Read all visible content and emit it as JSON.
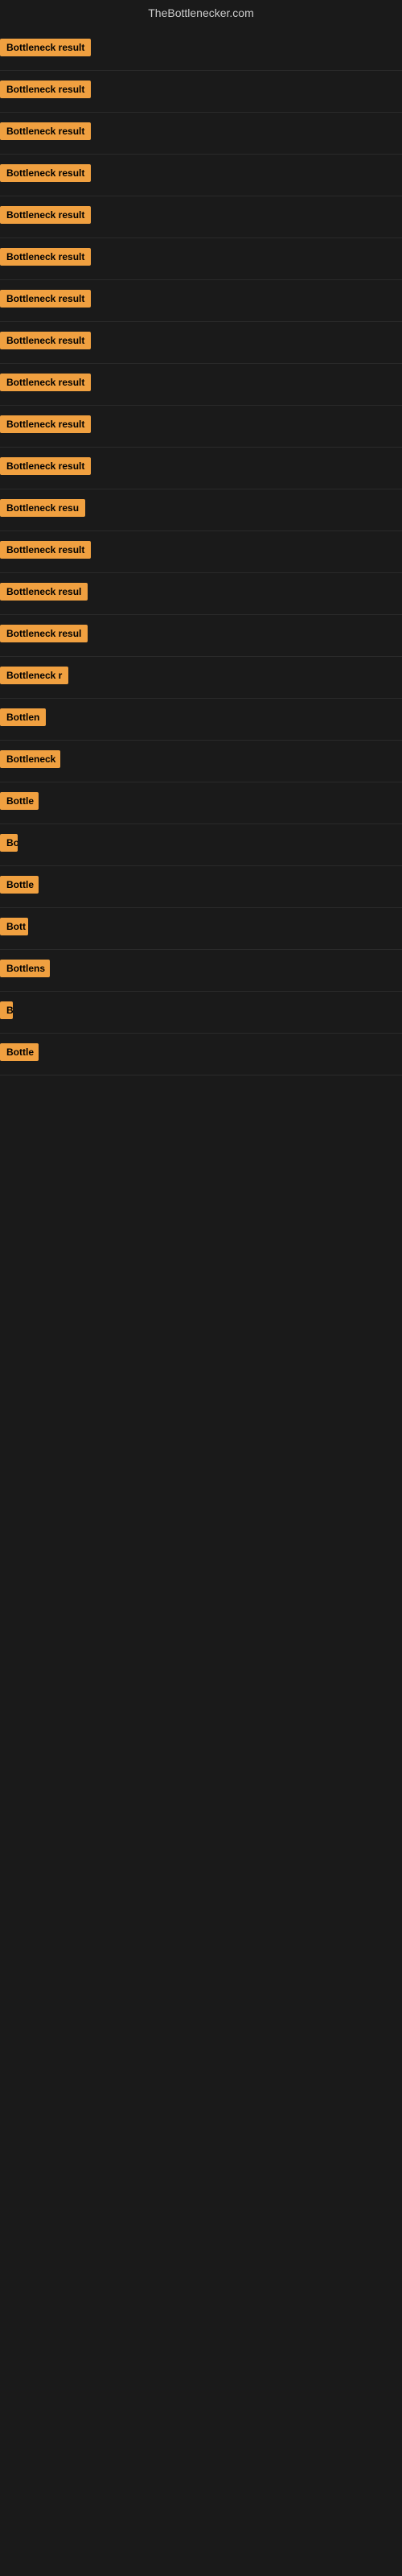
{
  "site": {
    "title": "TheBottlenecker.com"
  },
  "badges": [
    {
      "id": 1,
      "label": "Bottleneck result",
      "visible_width": "full"
    },
    {
      "id": 2,
      "label": "Bottleneck result",
      "visible_width": "full"
    },
    {
      "id": 3,
      "label": "Bottleneck result",
      "visible_width": "full"
    },
    {
      "id": 4,
      "label": "Bottleneck result",
      "visible_width": "full"
    },
    {
      "id": 5,
      "label": "Bottleneck result",
      "visible_width": "full"
    },
    {
      "id": 6,
      "label": "Bottleneck result",
      "visible_width": "full"
    },
    {
      "id": 7,
      "label": "Bottleneck result",
      "visible_width": "full"
    },
    {
      "id": 8,
      "label": "Bottleneck result",
      "visible_width": "full"
    },
    {
      "id": 9,
      "label": "Bottleneck result",
      "visible_width": "full"
    },
    {
      "id": 10,
      "label": "Bottleneck result",
      "visible_width": "full"
    },
    {
      "id": 11,
      "label": "Bottleneck result",
      "visible_width": "full"
    },
    {
      "id": 12,
      "label": "Bottleneck resu",
      "visible_width": "partial_1"
    },
    {
      "id": 13,
      "label": "Bottleneck result",
      "visible_width": "full"
    },
    {
      "id": 14,
      "label": "Bottleneck resul",
      "visible_width": "partial_2"
    },
    {
      "id": 15,
      "label": "Bottleneck resul",
      "visible_width": "partial_2"
    },
    {
      "id": 16,
      "label": "Bottleneck r",
      "visible_width": "partial_3"
    },
    {
      "id": 17,
      "label": "Bottlen",
      "visible_width": "partial_4"
    },
    {
      "id": 18,
      "label": "Bottleneck",
      "visible_width": "partial_5"
    },
    {
      "id": 19,
      "label": "Bottle",
      "visible_width": "partial_6"
    },
    {
      "id": 20,
      "label": "Bo",
      "visible_width": "partial_7"
    },
    {
      "id": 21,
      "label": "Bottle",
      "visible_width": "partial_6"
    },
    {
      "id": 22,
      "label": "Bott",
      "visible_width": "partial_8"
    },
    {
      "id": 23,
      "label": "Bottlens",
      "visible_width": "partial_9"
    },
    {
      "id": 24,
      "label": "B",
      "visible_width": "partial_10"
    },
    {
      "id": 25,
      "label": "Bottle",
      "visible_width": "partial_6"
    }
  ],
  "colors": {
    "badge_bg": "#f0a040",
    "badge_text": "#000000",
    "page_bg": "#1a1a1a",
    "header_text": "#cccccc",
    "divider": "#2a2a2a"
  }
}
